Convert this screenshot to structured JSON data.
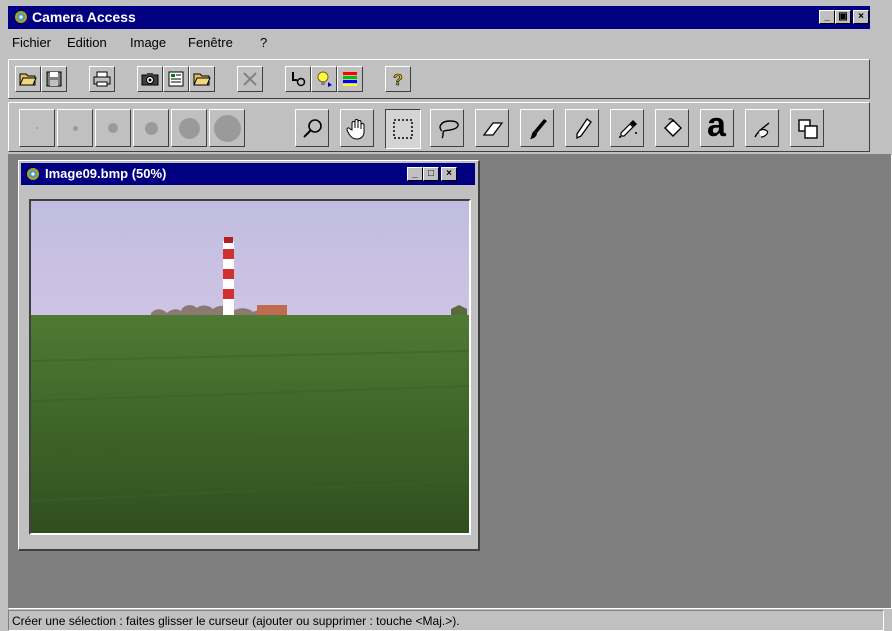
{
  "app": {
    "title": "Camera Access",
    "icon": "camera-access-icon"
  },
  "window_controls": {
    "minimize": "_",
    "restore": "▣",
    "close": "×"
  },
  "menu": [
    {
      "id": "fichier",
      "label": "Fichier"
    },
    {
      "id": "edition",
      "label": "Edition"
    },
    {
      "id": "image",
      "label": "Image"
    },
    {
      "id": "fenetre",
      "label": "Fenêtre"
    },
    {
      "id": "help",
      "label": "?"
    }
  ],
  "toolbar1": [
    {
      "name": "open-button",
      "icon": "folder-open-icon"
    },
    {
      "name": "save-button",
      "icon": "floppy-disk-icon"
    },
    {
      "name": "print-button",
      "icon": "printer-icon"
    },
    {
      "name": "camera-button",
      "icon": "camera-icon"
    },
    {
      "name": "catalog-button",
      "icon": "catalog-icon"
    },
    {
      "name": "open-folder-button",
      "icon": "folder-open-icon"
    },
    {
      "name": "delete-button",
      "icon": "cross-icon"
    },
    {
      "name": "connect-button",
      "icon": "connect-icon"
    },
    {
      "name": "brightness-button",
      "icon": "bulb-icon"
    },
    {
      "name": "colors-button",
      "icon": "color-bars-icon"
    },
    {
      "name": "help-button",
      "icon": "question-icon"
    }
  ],
  "toolbar2": {
    "brush_sizes": [
      "1",
      "2",
      "3",
      "4",
      "5",
      "6"
    ],
    "tools": [
      {
        "name": "zoom-tool",
        "icon": "magnifier-icon"
      },
      {
        "name": "hand-tool",
        "icon": "hand-icon"
      },
      {
        "name": "rect-select-tool",
        "icon": "marquee-icon",
        "active": true
      },
      {
        "name": "lasso-tool",
        "icon": "lasso-icon"
      },
      {
        "name": "eraser-tool",
        "icon": "eraser-icon"
      },
      {
        "name": "brush-tool",
        "icon": "brush-icon"
      },
      {
        "name": "pencil-tool",
        "icon": "pencil-icon"
      },
      {
        "name": "eyedropper-tool",
        "icon": "eyedropper-icon"
      },
      {
        "name": "fill-tool",
        "icon": "paint-bucket-icon"
      },
      {
        "name": "text-tool",
        "icon": "text-a-icon",
        "glyph": "a"
      },
      {
        "name": "smudge-tool",
        "icon": "smudge-hand-icon"
      },
      {
        "name": "clone-tool",
        "icon": "layers-icon"
      }
    ]
  },
  "child_window": {
    "title": "Image09.bmp (50%)",
    "icon": "camera-access-icon"
  },
  "status": {
    "text": "Créer une sélection : faites glisser le curseur (ajouter ou supprimer : touche <Maj.>)."
  },
  "colors": {
    "titlebar": "#000080",
    "workspace": "#7f7f7f",
    "face": "#c0c0c0"
  }
}
